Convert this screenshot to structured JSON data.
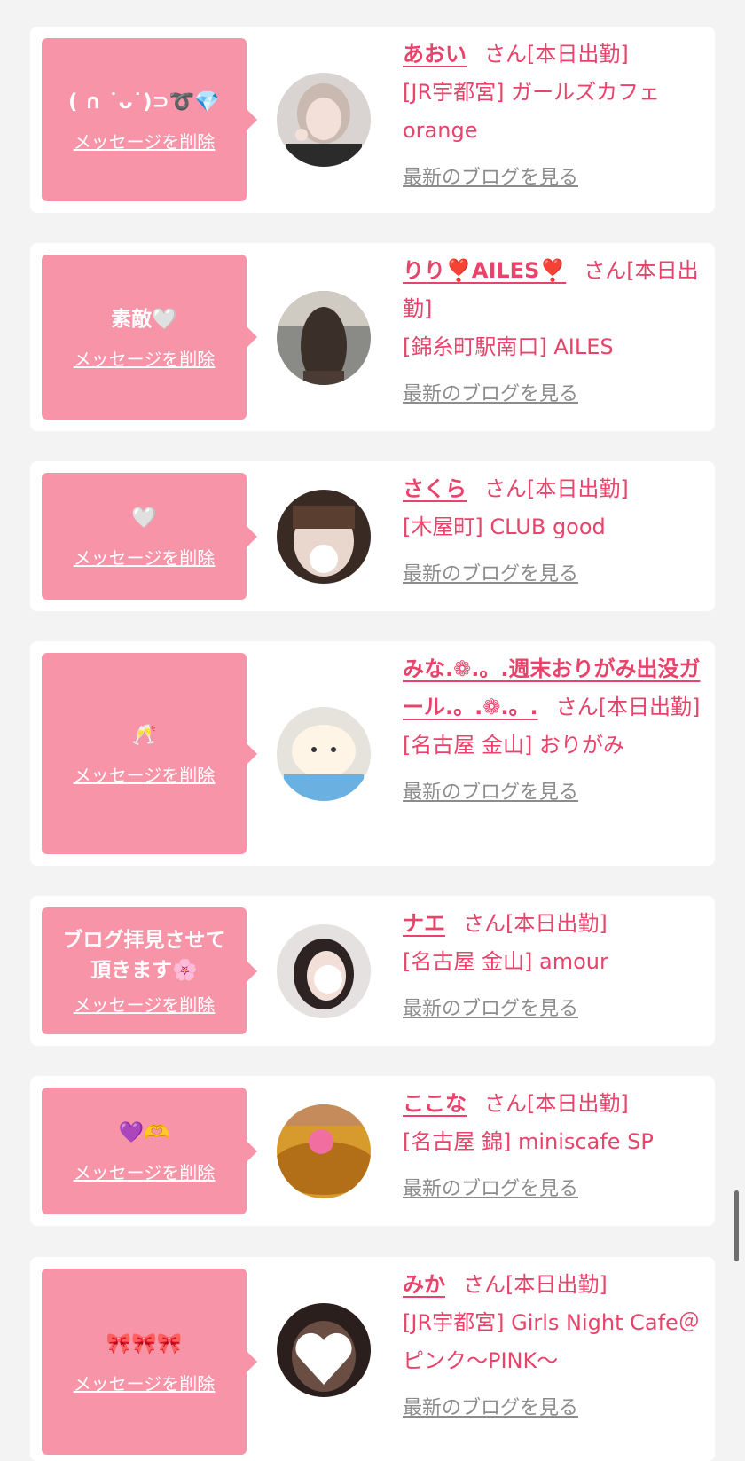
{
  "common": {
    "delete_label": "メッセージを削除",
    "san_suffix": "さん[本日出勤]",
    "blog_label": "最新のブログを見る"
  },
  "items": [
    {
      "message": "( ∩ ˙ᴗ˙)⊃➰💎",
      "name": "あおい",
      "shop": "[JR宇都宮] ガールズカフェorange"
    },
    {
      "message": "素敵🤍",
      "name": "りり❣️AILES❣️",
      "shop": "[錦糸町駅南口] AILES"
    },
    {
      "message": "🤍",
      "name": "さくら",
      "shop": "[木屋町] CLUB good"
    },
    {
      "message": "🥂",
      "name": "みな.❁.。.週末おりがみ出没ガール.。.❁.。.",
      "shop": "[名古屋 金山] おりがみ"
    },
    {
      "message": "ブログ拝見させて\n頂きます🌸",
      "name": "ナエ",
      "shop": "[名古屋 金山] amour"
    },
    {
      "message": "💜🫶",
      "name": "ここな",
      "shop": "[名古屋 錦] miniscafe SP"
    },
    {
      "message": "🎀🎀🎀",
      "name": "みか",
      "shop": "[JR宇都宮] Girls Night Cafe＠ピンク〜PINK〜"
    }
  ],
  "colors": {
    "accent": "#e8436a",
    "bubble": "#f794a8",
    "background": "#f3f3f3",
    "card": "#ffffff",
    "blog_link": "#8c8c8c"
  }
}
